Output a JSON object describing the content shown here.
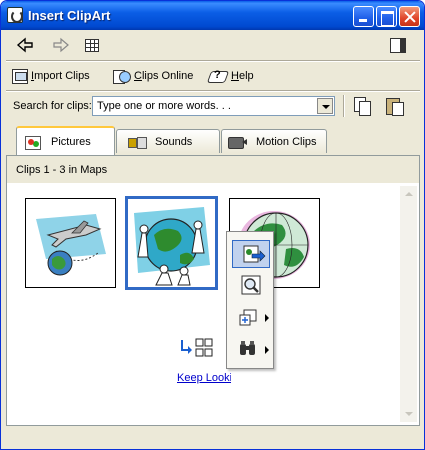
{
  "window": {
    "title": "Insert ClipArt",
    "controls": [
      "minimize",
      "maximize",
      "close"
    ]
  },
  "nav": {
    "back_icon": "back-arrow-icon",
    "forward_icon": "forward-arrow-icon",
    "view_icon": "clip-grid-icon",
    "pane_icon": "change-pane-icon"
  },
  "links": {
    "import_pre": "",
    "import_u": "I",
    "import_post": "mport Clips",
    "online_pre": "",
    "online_u": "C",
    "online_post": "lips Online",
    "help_pre": "",
    "help_u": "H",
    "help_post": "elp"
  },
  "search": {
    "label": "Search for clips:",
    "placeholder": "Type one or more words. . ."
  },
  "tabs": [
    {
      "label": "Pictures",
      "icon": "pictures-icon",
      "active": true
    },
    {
      "label": "Sounds",
      "icon": "sounds-icon",
      "active": false
    },
    {
      "label": "Motion Clips",
      "icon": "motion-clips-icon",
      "active": false
    }
  ],
  "content": {
    "header": "Clips 1 - 3 in Maps",
    "clips": [
      {
        "subject": "airplane-globe",
        "selected": false
      },
      {
        "subject": "people-around-globe",
        "selected": true
      },
      {
        "subject": "globe",
        "selected": false
      }
    ],
    "keep_looking_link": "Keep Looki"
  },
  "popup_menu": {
    "items": [
      {
        "icon": "insert-clip-icon",
        "submenu": false,
        "active": true
      },
      {
        "icon": "preview-clip-icon",
        "submenu": false,
        "active": false
      },
      {
        "icon": "add-to-category-icon",
        "submenu": true,
        "active": false
      },
      {
        "icon": "find-similar-icon",
        "submenu": true,
        "active": false
      }
    ]
  },
  "colors": {
    "titlebar": "#0b5ee6",
    "selection": "#316ac5",
    "link": "#0000cc",
    "window_bg": "#ece9d8"
  }
}
